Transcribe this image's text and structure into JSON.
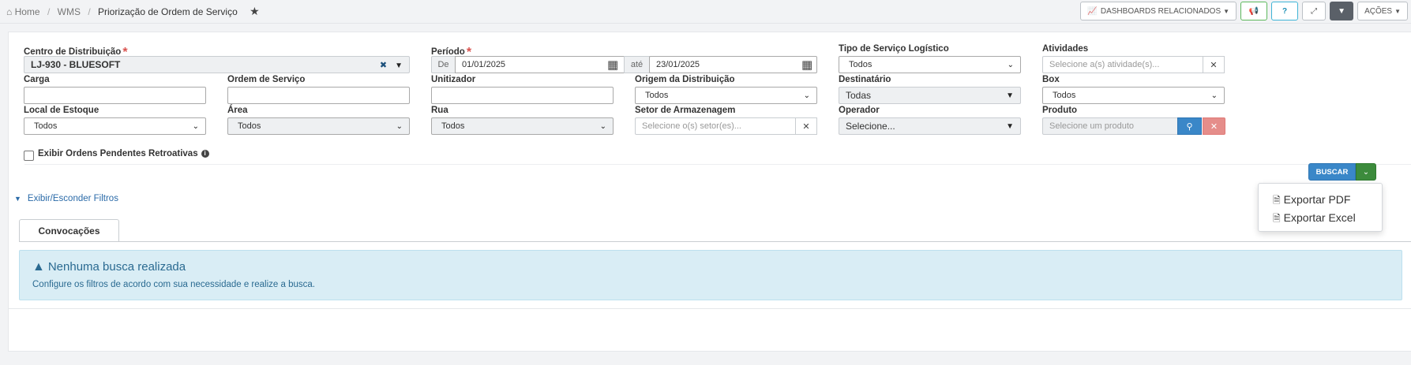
{
  "breadcrumb": {
    "home": "Home",
    "module": "WMS",
    "current": "Priorização de Ordem de Serviço",
    "star_icon": "★"
  },
  "top_actions": {
    "dashboards": "DASHBOARDS RELACIONADOS",
    "actions": "AÇÕES"
  },
  "filters": {
    "centro": {
      "label": "Centro de Distribuição",
      "value": "LJ-930 - BLUESOFT"
    },
    "periodo": {
      "label": "Período",
      "de": "De",
      "from": "01/01/2025",
      "ate": "até",
      "to": "23/01/2025"
    },
    "tipo_servico": {
      "label": "Tipo de Serviço Logístico",
      "value": "Todos"
    },
    "atividades": {
      "label": "Atividades",
      "placeholder": "Selecione a(s) atividade(s)..."
    },
    "carga": {
      "label": "Carga",
      "value": ""
    },
    "ordem_servico": {
      "label": "Ordem de Serviço",
      "value": ""
    },
    "unitizador": {
      "label": "Unitizador",
      "value": ""
    },
    "origem": {
      "label": "Origem da Distribuição",
      "value": "Todos"
    },
    "destinatario": {
      "label": "Destinatário",
      "value": "Todas"
    },
    "box": {
      "label": "Box",
      "value": "Todos"
    },
    "local_estoque": {
      "label": "Local de Estoque",
      "value": "Todos"
    },
    "area": {
      "label": "Área",
      "value": "Todos"
    },
    "rua": {
      "label": "Rua",
      "value": "Todos"
    },
    "setor": {
      "label": "Setor de Armazenagem",
      "placeholder": "Selecione o(s) setor(es)..."
    },
    "operador": {
      "label": "Operador",
      "value": "Selecione..."
    },
    "produto": {
      "label": "Produto",
      "placeholder": "Selecione um produto"
    },
    "retroativas": {
      "label": "Exibir Ordens Pendentes Retroativas",
      "checked": false
    }
  },
  "search": {
    "label": "BUSCAR"
  },
  "export_menu": {
    "pdf": "Exportar PDF",
    "excel": "Exportar Excel"
  },
  "toggle_filters": "Exibir/Esconder Filtros",
  "tabs": [
    {
      "label": "Convocações",
      "active": true
    }
  ],
  "alert": {
    "title": "Nenhuma busca realizada",
    "text": "Configure os filtros de acordo com sua necessidade e realize a busca."
  },
  "colors": {
    "primary": "#3a87c8",
    "success": "#3c8b3c",
    "danger": "#d9534f",
    "info_bg": "#d9edf5",
    "info_text": "#2a6a91"
  }
}
